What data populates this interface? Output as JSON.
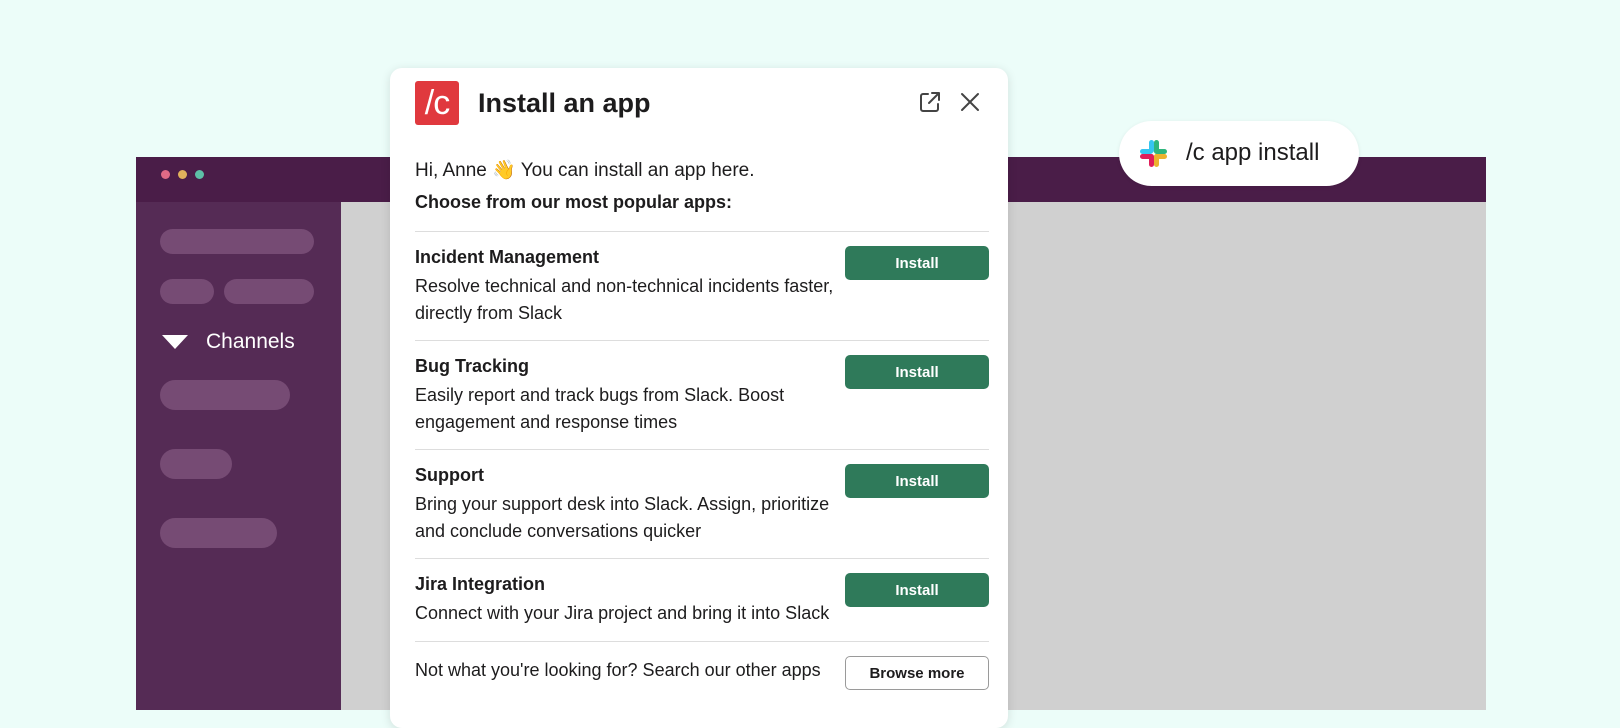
{
  "background_window": {
    "sidebar": {
      "channels_label": "Channels"
    }
  },
  "modal": {
    "logo_text": "/c",
    "title": "Install an app",
    "greeting": "Hi, Anne 👋 You can install an app here.",
    "subtitle": "Choose from our most popular apps:",
    "apps": [
      {
        "name": "Incident Management",
        "description": "Resolve technical and non-technical incidents faster, directly from Slack",
        "button": "Install"
      },
      {
        "name": "Bug Tracking",
        "description": "Easily report and track bugs from Slack. Boost engagement and response times",
        "button": "Install"
      },
      {
        "name": "Support",
        "description": "Bring your support desk into Slack. Assign, prioritize and conclude conversations quicker",
        "button": "Install"
      },
      {
        "name": "Jira Integration",
        "description": "Connect with your Jira project and bring it into Slack",
        "button": "Install"
      }
    ],
    "footer": {
      "text": "Not what you're looking for? Search our other apps",
      "button": "Browse more"
    }
  },
  "command_pill": {
    "text": "/c app install"
  },
  "colors": {
    "page_background": "#ecfdf9",
    "titlebar": "#4a1d48",
    "sidebar": "#552b55",
    "install_button": "#2f7a5a",
    "logo_red": "#e0393e"
  },
  "icons": {
    "external_link": "external-link-icon",
    "close": "close-icon",
    "slack": "slack-logo-icon",
    "caret": "caret-down-icon"
  }
}
